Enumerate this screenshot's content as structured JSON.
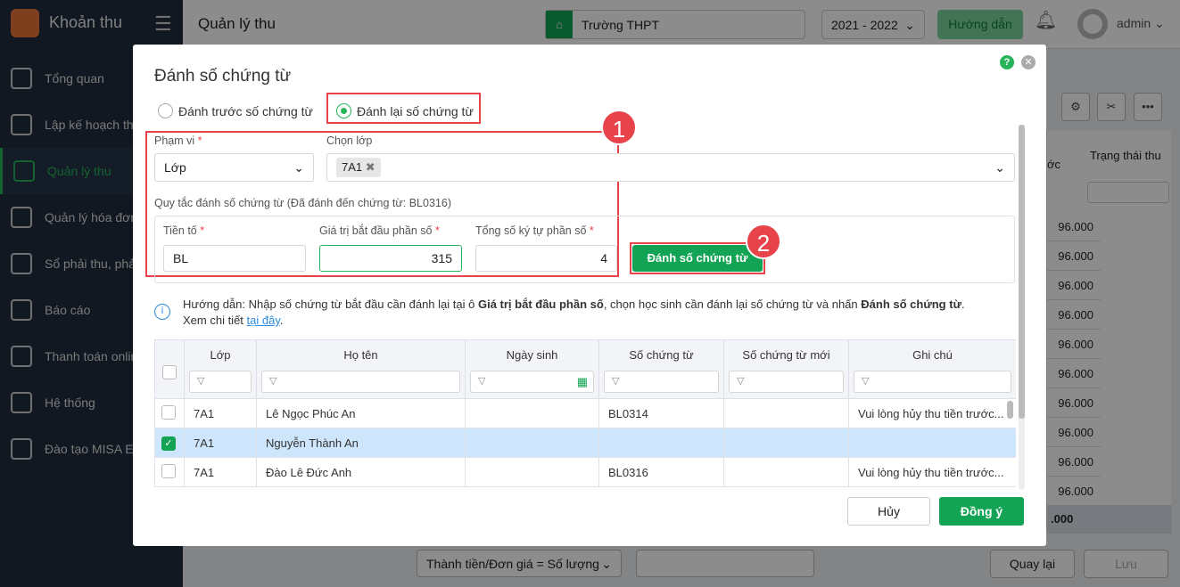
{
  "app": {
    "title": "Khoản thu"
  },
  "sidebar": {
    "items": [
      {
        "label": "Tổng quan",
        "icon": "bar-chart-icon"
      },
      {
        "label": "Lập kế hoạch thu",
        "icon": "calendar-money-icon"
      },
      {
        "label": "Quản lý thu",
        "icon": "hand-coin-icon",
        "active": true
      },
      {
        "label": "Quản lý hóa đơn",
        "icon": "invoice-icon"
      },
      {
        "label": "Sổ phải thu, phải trả",
        "icon": "ledger-icon"
      },
      {
        "label": "Báo cáo",
        "icon": "pie-chart-icon"
      },
      {
        "label": "Thanh toán online",
        "icon": "card-icon"
      },
      {
        "label": "Hệ thống",
        "icon": "gear-icon"
      },
      {
        "label": "Đào tạo MISA EMIS",
        "icon": "book-icon"
      }
    ]
  },
  "header": {
    "page_title": "Quản lý thu",
    "school": "Trường THPT",
    "year": "2021 - 2022",
    "guide": "Hướng dẫn",
    "user": "admin"
  },
  "background": {
    "col_partial": "ớc",
    "col_status": "Trạng thái thu",
    "amounts": [
      "96.000",
      "96.000",
      "96.000",
      "96.000",
      "96.000",
      "96.000",
      "96.000",
      "96.000",
      "96.000",
      "96.000"
    ],
    "total": ".000",
    "formula": "Thành tiền/Đơn giá = Số lượng",
    "back": "Quay lại",
    "save": "Lưu"
  },
  "modal": {
    "title": "Đánh số chứng từ",
    "radio_before": "Đánh trước số chứng từ",
    "radio_renumber": "Đánh lại số chứng từ",
    "scope_label": "Phạm vi",
    "scope_value": "Lớp",
    "class_label": "Chọn lớp",
    "class_chip": "7A1",
    "rule_label": "Quy tắc đánh số chứng từ (Đã đánh đến chứng từ: BL0316)",
    "prefix_label": "Tiền tố",
    "prefix_value": "BL",
    "start_label": "Giá trị bắt đầu phần số",
    "start_value": "315",
    "digits_label": "Tổng số ký tự phần số",
    "digits_value": "4",
    "number_button": "Đánh số chứng từ",
    "badge1": "1",
    "badge2": "2",
    "info_pre": "Hướng dẫn: Nhập số chứng từ bắt đầu cần đánh lại tại ô ",
    "info_b1": "Giá trị bắt đầu phần số",
    "info_mid": ", chọn học sinh cần đánh lại số chứng từ và nhấn ",
    "info_b2": "Đánh số chứng từ",
    "info_end": ".",
    "info_more": "Xem chi tiết ",
    "info_link": "tại đây",
    "columns": [
      "Lớp",
      "Họ tên",
      "Ngày sinh",
      "Số chứng từ",
      "Số chứng từ mới",
      "Ghi chú"
    ],
    "rows": [
      {
        "class": "7A1",
        "name": "Lê Ngọc Phúc An",
        "dob": "",
        "voucher": "BL0314",
        "new": "",
        "note": "Vui lòng hủy thu tiền trước...",
        "checked": false
      },
      {
        "class": "7A1",
        "name": "Nguyễn Thành An",
        "dob": "",
        "voucher": "",
        "new": "",
        "note": "",
        "checked": true
      },
      {
        "class": "7A1",
        "name": "Đào Lê Đức Anh",
        "dob": "",
        "voucher": "BL0316",
        "new": "",
        "note": "Vui lòng hủy thu tiền trước...",
        "checked": false
      }
    ],
    "cancel": "Hủy",
    "ok": "Đồng ý"
  },
  "colors": {
    "accent": "#12a454",
    "highlight": "#e8434a",
    "selected_row": "#cde6fb"
  }
}
